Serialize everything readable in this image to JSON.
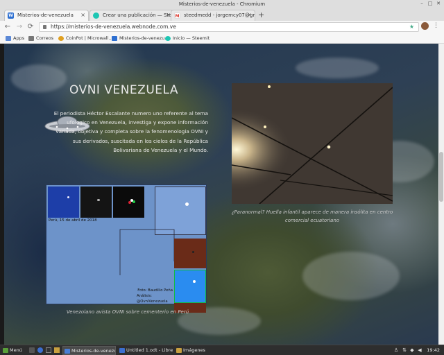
{
  "window": {
    "title": "Misterios-de-venezuela - Chromium",
    "controls": [
      "minimize-icon",
      "maximize-icon",
      "close-icon"
    ]
  },
  "tabs": [
    {
      "label": "Misterios-de-venezuela",
      "favicon": "W",
      "favicon_color": "#2d6fd1",
      "active": true
    },
    {
      "label": "Crear una publicación — Steem",
      "favicon": "steemit-icon",
      "favicon_color": "#1ec6b3",
      "active": false
    },
    {
      "label": "steedmedd - jorgemcy07@gm...",
      "favicon": "M",
      "favicon_color": "#d93025",
      "active": false
    }
  ],
  "toolbar": {
    "url": "https://misterios-de-venezuela.webnode.com.ve",
    "nav": [
      "back-icon",
      "forward-icon",
      "reload-icon"
    ]
  },
  "bookmarks": [
    {
      "label": "Apps",
      "icon": "apps-grid-icon",
      "color": "#5b88d6"
    },
    {
      "label": "Correos",
      "icon": "folder-icon",
      "color": "#777777"
    },
    {
      "label": "CoinPot | Microwall...",
      "icon": "coinpot-icon",
      "color": "#e0a020"
    },
    {
      "label": "Misterios-de-venezu...",
      "icon": "W",
      "color": "#2d6fd1"
    },
    {
      "label": "Inicio — Steemit",
      "icon": "steemit-icon",
      "color": "#1ec6b3"
    }
  ],
  "page": {
    "heading": "OVNI VENEZUELA",
    "intro": "El periodista Héctor Escalante numero uno referente al tema ufologico en Venezuela, investiga y expone información variada, objetiva y completa sobre la fenomenologia OVNI y sus derivados, suscitada en los cielos de la República Bolivariana de Venezuela y el Mundo.",
    "left_figure": {
      "date_label": "Perú, 15 de abril de 2018",
      "credit_line1": "Foto: Baudilio Peña",
      "credit_line2": "Análisis: @OvniVenezuela"
    },
    "left_caption": "Venezolano avista OVNI sobre cementerio en Perú",
    "right_caption": "¿Paranormal? Huella infantil aparece de manera insólita en centro comercial ecuatoriano"
  },
  "taskbar": {
    "menu_label": "Menú",
    "windows": [
      {
        "label": "Misterios-de-venezu...",
        "icon_color": "#4a7fd6",
        "active": true
      },
      {
        "label": "Untitled 1.odt - Libre...",
        "icon_color": "#3c6fd0",
        "active": false
      },
      {
        "label": "Imágenes",
        "icon_color": "#c8a040",
        "active": false
      }
    ],
    "clock": "19:42"
  }
}
